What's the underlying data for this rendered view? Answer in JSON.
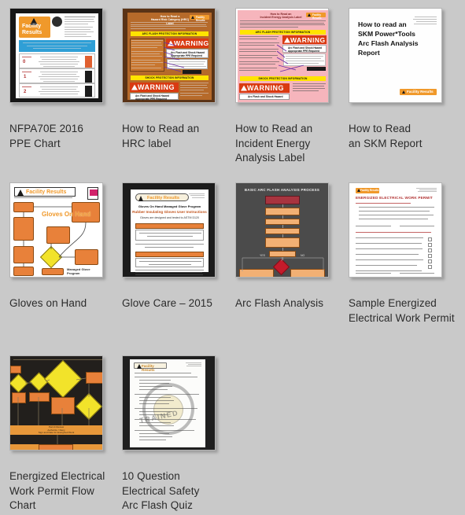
{
  "page": {
    "background_color": "#c9c9c9",
    "text_color": "#2b2b2b",
    "layout": "4-column thumbnail grid",
    "item_count": 10
  },
  "items": [
    {
      "id": "nfpa70e-2016-ppe-chart",
      "caption": "NFPA70E 2016\nPPE Chart",
      "thumbnail_kind": "ppe-chart",
      "thumbnail_alt": "NFPA 70E 2016 PPE category chart with Facility Results logo, blue header band and rows of PPE figures",
      "brand": "Facility Results",
      "accent_color": "#f0992b"
    },
    {
      "id": "how-to-read-an-hrc-label",
      "caption": "How to Read an\nHRC label",
      "thumbnail_kind": "hrc-label",
      "thumbnail_alt": "Brown annotated poster showing an arc flash WARNING label with callouts",
      "heading": "How to Read a\nHazard Risk Category (HRC) Label",
      "section_1": "ARC FLASH PROTECTION INFORMATION",
      "section_2": "SHOCK PROTECTION INFORMATION",
      "warning_word": "WARNING",
      "warning_sub": "Arc Flash and Shock Hazard\nAppropriate PPE Required",
      "accent_color": "#d93a11"
    },
    {
      "id": "how-to-read-an-incident-energy-analysis-label",
      "caption": "How to Read an\nIncident Energy\nAnalysis Label",
      "thumbnail_kind": "incident-energy-label",
      "thumbnail_alt": "Pink annotated poster showing an incident energy analysis WARNING label with purple callout arrows",
      "heading": "How to Read an\nIncident Energy Analysis Label",
      "section_1": "ARC FLASH PROTECTION INFORMATION",
      "section_2": "SHOCK PROTECTION INFORMATION",
      "warning_word": "WARNING",
      "warning_sub": "Arc Flash and Shock Hazard",
      "accent_color": "#d93a11"
    },
    {
      "id": "how-to-read-an-skm-report",
      "caption": "How to Read\nan SKM Report",
      "thumbnail_kind": "skm-report-cover",
      "thumbnail_alt": "White document cover titled How to read an SKM Power*Tools Arc Flash Analysis Report",
      "title": "How to read an SKM Power*Tools Arc Flash Analysis Report",
      "brand": "Facility Results",
      "accent_color": "#f0992b"
    },
    {
      "id": "gloves-on-hand",
      "caption": "Gloves on Hand",
      "thumbnail_kind": "gloves-flowchart",
      "thumbnail_alt": "Gloves On Hand managed glove program flowchart with orange and yellow boxes",
      "brand": "Facility Results",
      "program_name": "Gloves On Hand",
      "footer": "Managed Glove Program",
      "accent_color": "#e8813a"
    },
    {
      "id": "glove-care-2015",
      "caption": "Glove Care – 2015",
      "thumbnail_kind": "glove-care",
      "thumbnail_alt": "White instruction sheet on black background for rubber insulating glove user instructions",
      "brand": "Facility Results",
      "title": "Gloves On Hand Managed Glove Program",
      "subtitle": "Rubber Insulating Gloves User Instructions",
      "note": "Gloves are designed and tested to ASTM D120",
      "accent_color": "#e8813a"
    },
    {
      "id": "arc-flash-analysis",
      "caption": "Arc Flash Analysis",
      "thumbnail_kind": "arc-flash-process",
      "thumbnail_alt": "Dark gray process flowchart titled Basic Arc Flash Analysis Process with orange steps and a red decision diamond",
      "title": "BASIC ARC FLASH ANALYSIS PROCESS",
      "accent_color": "#f2b074"
    },
    {
      "id": "sample-energized-electrical-work-permit",
      "caption": "Sample Energized\nElectrical Work Permit",
      "thumbnail_kind": "work-permit-form",
      "thumbnail_alt": "White form page titled Energized Electrical Work Permit with numbered fields and checkboxes",
      "brand": "Facility Results",
      "title": "ENERGIZED ELECTRICAL WORK PERMIT",
      "accent_color": "#b03030"
    },
    {
      "id": "energized-electrical-work-permit-flow-chart",
      "caption": "Energized Electrical\nWork Permit Flow Chart",
      "thumbnail_kind": "permit-flowchart",
      "thumbnail_alt": "Dark flowchart with yellow diamonds and orange boxes for the energized electrical work permit process",
      "accent_color": "#e8983a"
    },
    {
      "id": "10-question-electrical-safety-arc-flash-quiz",
      "caption": "10 Question\nElectrical Safety\nArc Flash Quiz",
      "thumbnail_kind": "quiz-sheet",
      "thumbnail_alt": "Quiz sheet with a large gray TRAINED circular watermark stamp",
      "brand": "Facility Results",
      "stamp_text": "TRAINED",
      "accent_color": "#c8882a"
    }
  ]
}
